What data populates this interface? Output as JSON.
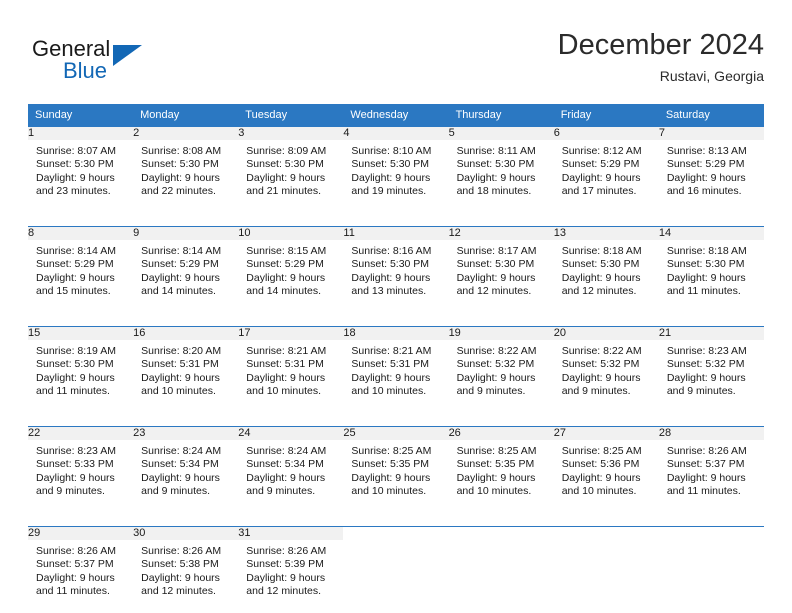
{
  "brand": {
    "name_part1": "General",
    "name_part2": "Blue",
    "logo_icon": "triangle-icon",
    "accent_color": "#1267b5"
  },
  "header": {
    "title": "December 2024",
    "subtitle": "Rustavi, Georgia"
  },
  "calendar": {
    "header_bg": "#2b78c2",
    "daynum_bg": "#f1f1f1",
    "weekdays": [
      "Sunday",
      "Monday",
      "Tuesday",
      "Wednesday",
      "Thursday",
      "Friday",
      "Saturday"
    ],
    "weeks": [
      [
        {
          "day": "1",
          "sunrise": "Sunrise: 8:07 AM",
          "sunset": "Sunset: 5:30 PM",
          "daylight1": "Daylight: 9 hours",
          "daylight2": "and 23 minutes."
        },
        {
          "day": "2",
          "sunrise": "Sunrise: 8:08 AM",
          "sunset": "Sunset: 5:30 PM",
          "daylight1": "Daylight: 9 hours",
          "daylight2": "and 22 minutes."
        },
        {
          "day": "3",
          "sunrise": "Sunrise: 8:09 AM",
          "sunset": "Sunset: 5:30 PM",
          "daylight1": "Daylight: 9 hours",
          "daylight2": "and 21 minutes."
        },
        {
          "day": "4",
          "sunrise": "Sunrise: 8:10 AM",
          "sunset": "Sunset: 5:30 PM",
          "daylight1": "Daylight: 9 hours",
          "daylight2": "and 19 minutes."
        },
        {
          "day": "5",
          "sunrise": "Sunrise: 8:11 AM",
          "sunset": "Sunset: 5:30 PM",
          "daylight1": "Daylight: 9 hours",
          "daylight2": "and 18 minutes."
        },
        {
          "day": "6",
          "sunrise": "Sunrise: 8:12 AM",
          "sunset": "Sunset: 5:29 PM",
          "daylight1": "Daylight: 9 hours",
          "daylight2": "and 17 minutes."
        },
        {
          "day": "7",
          "sunrise": "Sunrise: 8:13 AM",
          "sunset": "Sunset: 5:29 PM",
          "daylight1": "Daylight: 9 hours",
          "daylight2": "and 16 minutes."
        }
      ],
      [
        {
          "day": "8",
          "sunrise": "Sunrise: 8:14 AM",
          "sunset": "Sunset: 5:29 PM",
          "daylight1": "Daylight: 9 hours",
          "daylight2": "and 15 minutes."
        },
        {
          "day": "9",
          "sunrise": "Sunrise: 8:14 AM",
          "sunset": "Sunset: 5:29 PM",
          "daylight1": "Daylight: 9 hours",
          "daylight2": "and 14 minutes."
        },
        {
          "day": "10",
          "sunrise": "Sunrise: 8:15 AM",
          "sunset": "Sunset: 5:29 PM",
          "daylight1": "Daylight: 9 hours",
          "daylight2": "and 14 minutes."
        },
        {
          "day": "11",
          "sunrise": "Sunrise: 8:16 AM",
          "sunset": "Sunset: 5:30 PM",
          "daylight1": "Daylight: 9 hours",
          "daylight2": "and 13 minutes."
        },
        {
          "day": "12",
          "sunrise": "Sunrise: 8:17 AM",
          "sunset": "Sunset: 5:30 PM",
          "daylight1": "Daylight: 9 hours",
          "daylight2": "and 12 minutes."
        },
        {
          "day": "13",
          "sunrise": "Sunrise: 8:18 AM",
          "sunset": "Sunset: 5:30 PM",
          "daylight1": "Daylight: 9 hours",
          "daylight2": "and 12 minutes."
        },
        {
          "day": "14",
          "sunrise": "Sunrise: 8:18 AM",
          "sunset": "Sunset: 5:30 PM",
          "daylight1": "Daylight: 9 hours",
          "daylight2": "and 11 minutes."
        }
      ],
      [
        {
          "day": "15",
          "sunrise": "Sunrise: 8:19 AM",
          "sunset": "Sunset: 5:30 PM",
          "daylight1": "Daylight: 9 hours",
          "daylight2": "and 11 minutes."
        },
        {
          "day": "16",
          "sunrise": "Sunrise: 8:20 AM",
          "sunset": "Sunset: 5:31 PM",
          "daylight1": "Daylight: 9 hours",
          "daylight2": "and 10 minutes."
        },
        {
          "day": "17",
          "sunrise": "Sunrise: 8:21 AM",
          "sunset": "Sunset: 5:31 PM",
          "daylight1": "Daylight: 9 hours",
          "daylight2": "and 10 minutes."
        },
        {
          "day": "18",
          "sunrise": "Sunrise: 8:21 AM",
          "sunset": "Sunset: 5:31 PM",
          "daylight1": "Daylight: 9 hours",
          "daylight2": "and 10 minutes."
        },
        {
          "day": "19",
          "sunrise": "Sunrise: 8:22 AM",
          "sunset": "Sunset: 5:32 PM",
          "daylight1": "Daylight: 9 hours",
          "daylight2": "and 9 minutes."
        },
        {
          "day": "20",
          "sunrise": "Sunrise: 8:22 AM",
          "sunset": "Sunset: 5:32 PM",
          "daylight1": "Daylight: 9 hours",
          "daylight2": "and 9 minutes."
        },
        {
          "day": "21",
          "sunrise": "Sunrise: 8:23 AM",
          "sunset": "Sunset: 5:32 PM",
          "daylight1": "Daylight: 9 hours",
          "daylight2": "and 9 minutes."
        }
      ],
      [
        {
          "day": "22",
          "sunrise": "Sunrise: 8:23 AM",
          "sunset": "Sunset: 5:33 PM",
          "daylight1": "Daylight: 9 hours",
          "daylight2": "and 9 minutes."
        },
        {
          "day": "23",
          "sunrise": "Sunrise: 8:24 AM",
          "sunset": "Sunset: 5:34 PM",
          "daylight1": "Daylight: 9 hours",
          "daylight2": "and 9 minutes."
        },
        {
          "day": "24",
          "sunrise": "Sunrise: 8:24 AM",
          "sunset": "Sunset: 5:34 PM",
          "daylight1": "Daylight: 9 hours",
          "daylight2": "and 9 minutes."
        },
        {
          "day": "25",
          "sunrise": "Sunrise: 8:25 AM",
          "sunset": "Sunset: 5:35 PM",
          "daylight1": "Daylight: 9 hours",
          "daylight2": "and 10 minutes."
        },
        {
          "day": "26",
          "sunrise": "Sunrise: 8:25 AM",
          "sunset": "Sunset: 5:35 PM",
          "daylight1": "Daylight: 9 hours",
          "daylight2": "and 10 minutes."
        },
        {
          "day": "27",
          "sunrise": "Sunrise: 8:25 AM",
          "sunset": "Sunset: 5:36 PM",
          "daylight1": "Daylight: 9 hours",
          "daylight2": "and 10 minutes."
        },
        {
          "day": "28",
          "sunrise": "Sunrise: 8:26 AM",
          "sunset": "Sunset: 5:37 PM",
          "daylight1": "Daylight: 9 hours",
          "daylight2": "and 11 minutes."
        }
      ],
      [
        {
          "day": "29",
          "sunrise": "Sunrise: 8:26 AM",
          "sunset": "Sunset: 5:37 PM",
          "daylight1": "Daylight: 9 hours",
          "daylight2": "and 11 minutes."
        },
        {
          "day": "30",
          "sunrise": "Sunrise: 8:26 AM",
          "sunset": "Sunset: 5:38 PM",
          "daylight1": "Daylight: 9 hours",
          "daylight2": "and 12 minutes."
        },
        {
          "day": "31",
          "sunrise": "Sunrise: 8:26 AM",
          "sunset": "Sunset: 5:39 PM",
          "daylight1": "Daylight: 9 hours",
          "daylight2": "and 12 minutes."
        },
        {
          "day": "",
          "sunrise": "",
          "sunset": "",
          "daylight1": "",
          "daylight2": ""
        },
        {
          "day": "",
          "sunrise": "",
          "sunset": "",
          "daylight1": "",
          "daylight2": ""
        },
        {
          "day": "",
          "sunrise": "",
          "sunset": "",
          "daylight1": "",
          "daylight2": ""
        },
        {
          "day": "",
          "sunrise": "",
          "sunset": "",
          "daylight1": "",
          "daylight2": ""
        }
      ]
    ]
  }
}
